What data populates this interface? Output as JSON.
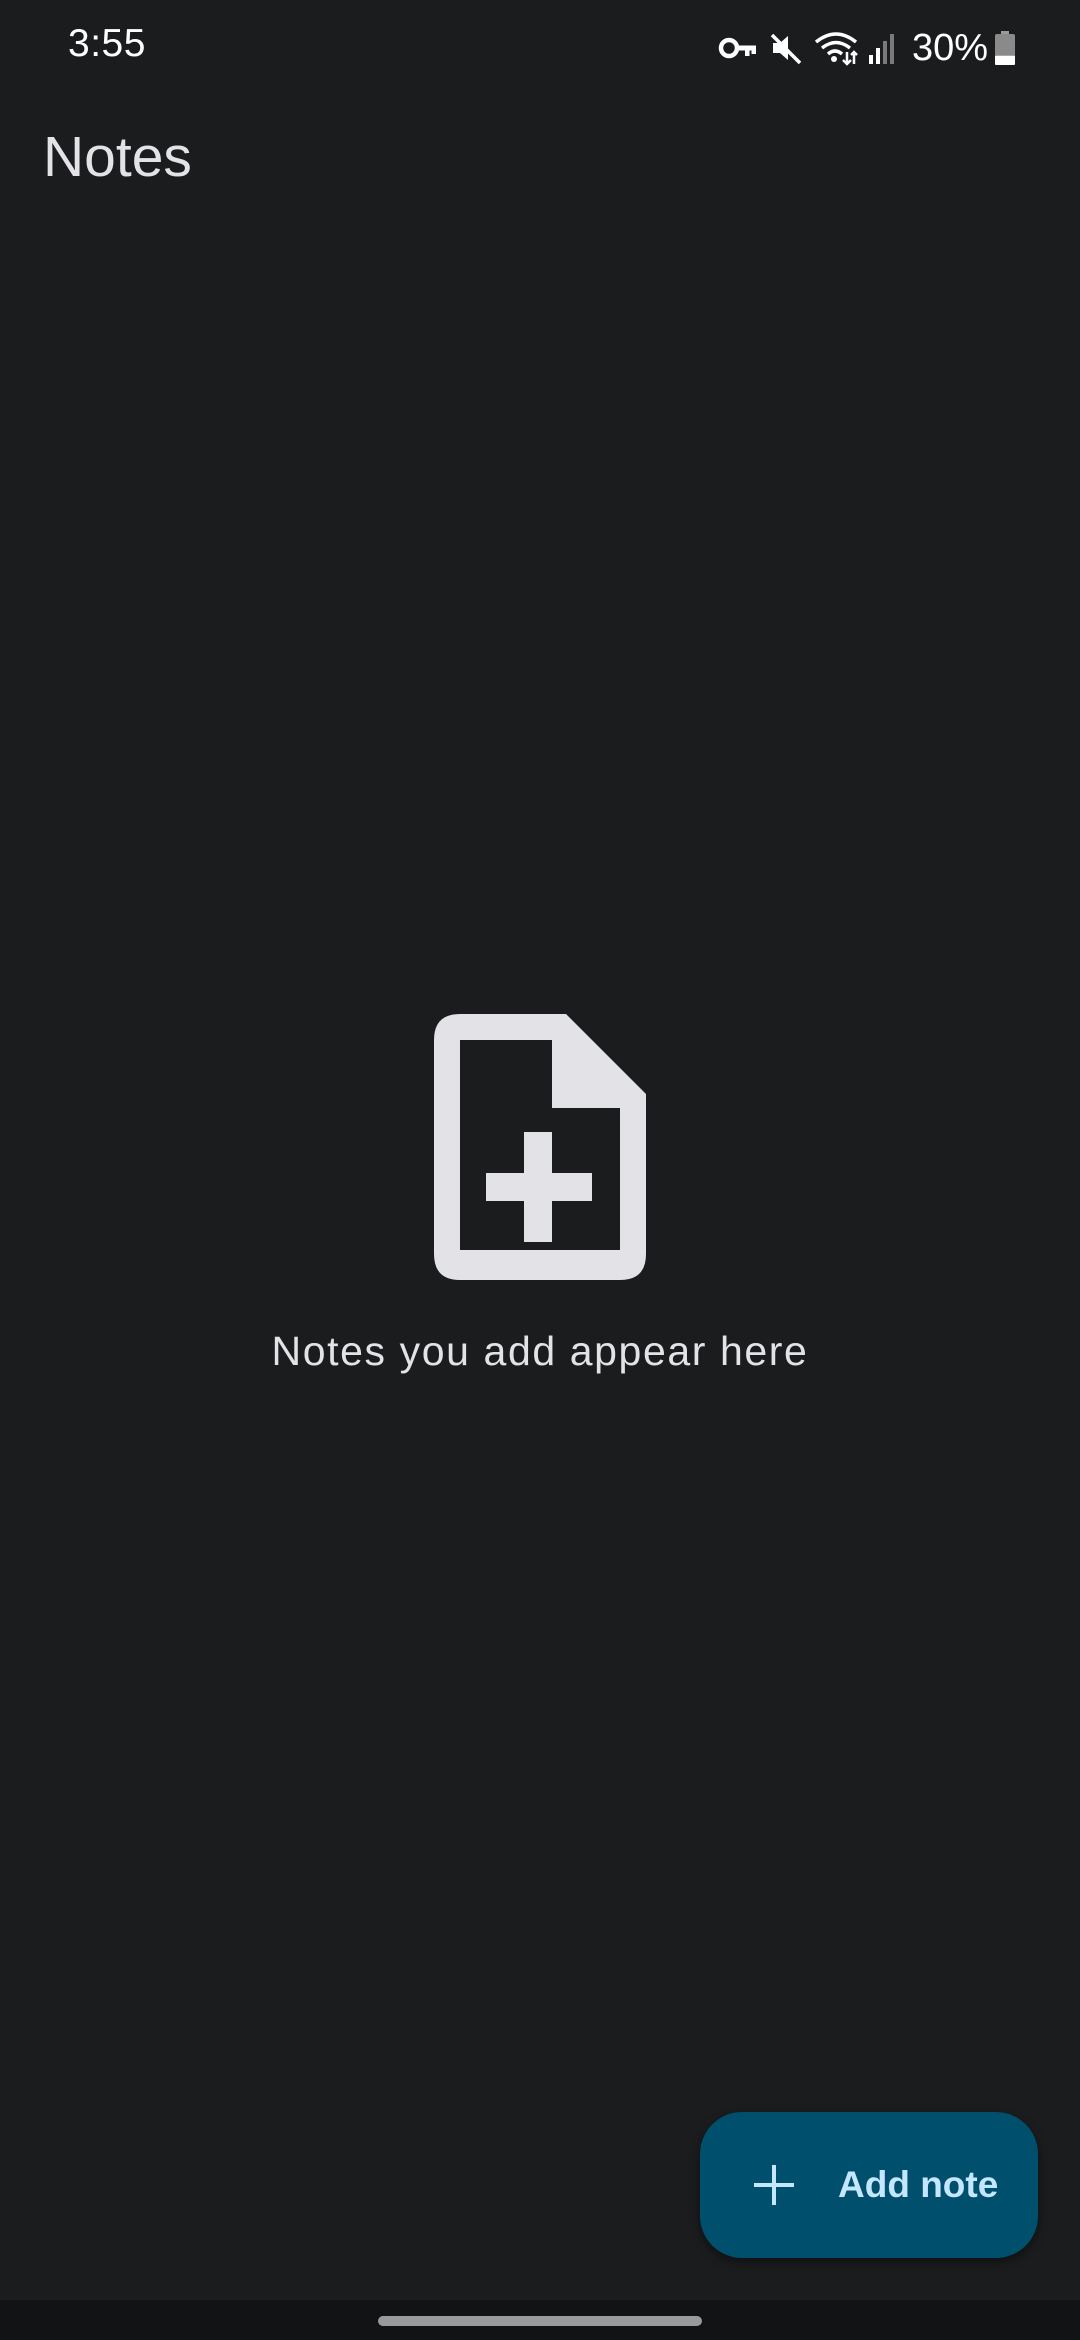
{
  "status_bar": {
    "time": "3:55",
    "battery_percent": "30%",
    "battery_level": 0.3,
    "icons": [
      "vpn-key-icon",
      "mute-icon",
      "wifi-icon",
      "signal-icon",
      "battery-icon"
    ]
  },
  "header": {
    "title": "Notes"
  },
  "empty_state": {
    "icon": "note-add-icon",
    "message": "Notes you add appear here"
  },
  "fab": {
    "icon": "plus-icon",
    "label": "Add note"
  },
  "colors": {
    "background": "#1a1c1e",
    "fab_background": "#004f6c",
    "fab_text": "#c4e7ff",
    "text": "#e3e2e6"
  }
}
